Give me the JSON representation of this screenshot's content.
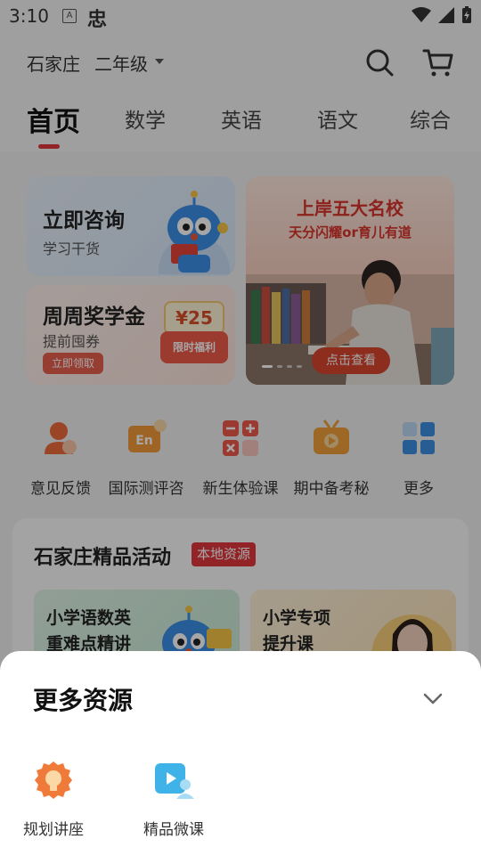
{
  "status_bar": {
    "time": "3:10",
    "icon_a": "A",
    "icon_b": "忠"
  },
  "topbar": {
    "city": "石家庄",
    "grade": "二年级"
  },
  "tabs": [
    "首页",
    "数学",
    "英语",
    "语文",
    "综合"
  ],
  "cards": {
    "consult": {
      "title": "立即咨询",
      "subtitle": "学习干货"
    },
    "scholarship": {
      "title": "周周奖学金",
      "subtitle": "提前囤券",
      "button": "立即领取",
      "coupon_amount": "¥25",
      "coupon_label": "限时福利"
    }
  },
  "banner": {
    "title": "上岸五大名校",
    "subtitle": "天分闪耀or育儿有道",
    "button": "点击查看"
  },
  "quick_links": [
    {
      "label": "意见反馈",
      "icon": "feedback-icon"
    },
    {
      "label": "国际测评咨",
      "icon": "international-test-icon",
      "icon_text": "En"
    },
    {
      "label": "新生体验课",
      "icon": "calculator-icon"
    },
    {
      "label": "期中备考秘",
      "icon": "tv-icon"
    },
    {
      "label": "更多",
      "icon": "grid-icon"
    }
  ],
  "activity": {
    "title": "石家庄精品活动",
    "badge": "本地资源",
    "cards": [
      {
        "title_line1": "小学语数英",
        "title_line2": "重难点精讲"
      },
      {
        "title_line1": "小学专项",
        "title_line2": "提升课"
      }
    ]
  },
  "sheet": {
    "title": "更多资源",
    "items": [
      {
        "label": "规划讲座",
        "icon": "lightbulb-icon"
      },
      {
        "label": "精品微课",
        "icon": "video-course-icon"
      }
    ]
  },
  "colors": {
    "accent": "#e0373b",
    "sheet_bg": "#ffffff",
    "overlay": "rgba(0,0,0,0.35)"
  }
}
